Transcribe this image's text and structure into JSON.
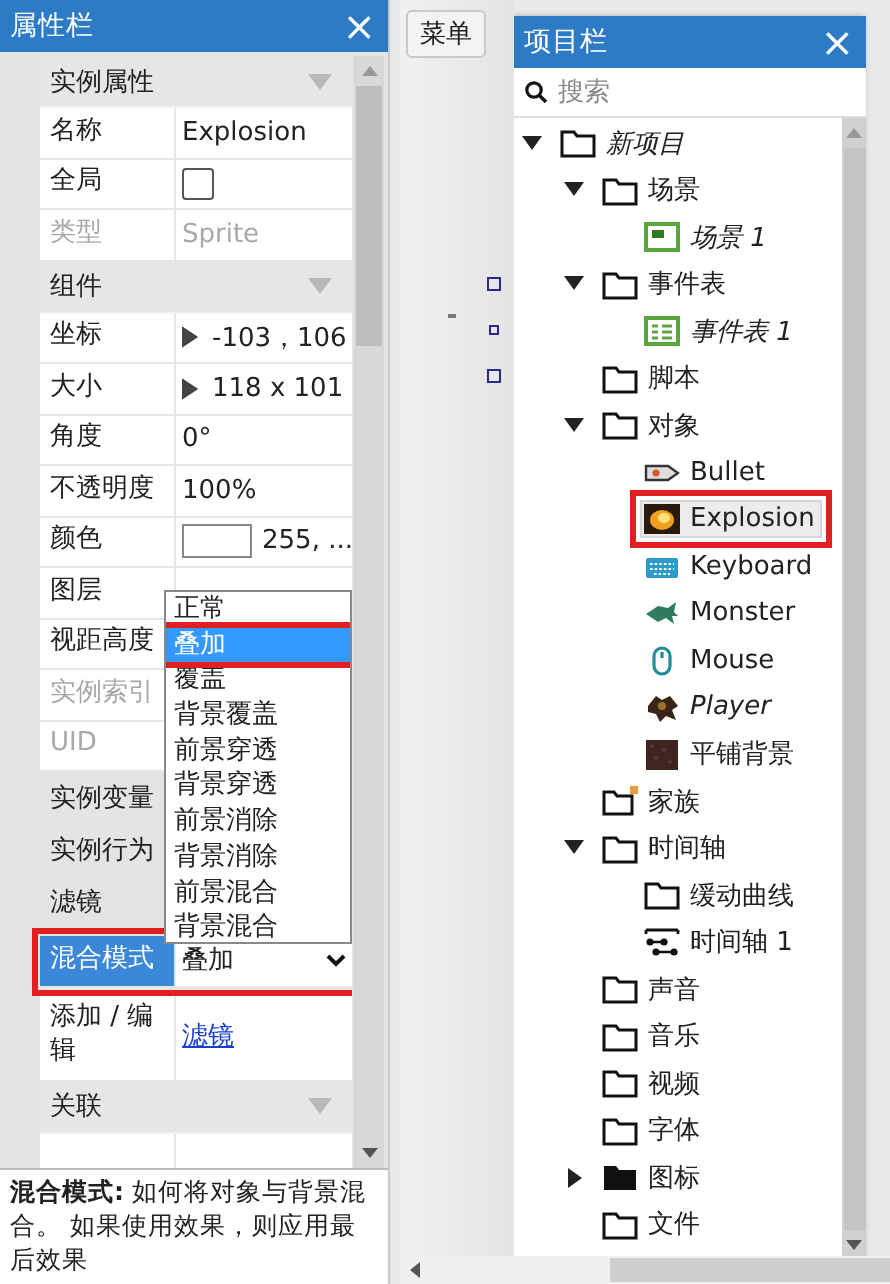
{
  "properties_panel": {
    "title": "属性栏",
    "close": "×",
    "rows": [
      {
        "kind": "section",
        "label": "实例属性"
      },
      {
        "kind": "text",
        "label": "名称",
        "value": "Explosion",
        "disabled": false,
        "selected": false
      },
      {
        "kind": "checkbox",
        "label": "全局",
        "checked": false,
        "disabled": false,
        "selected": false
      },
      {
        "kind": "text",
        "label": "类型",
        "value": "Sprite",
        "disabled": true,
        "selected": false
      },
      {
        "kind": "section",
        "label": "组件"
      },
      {
        "kind": "text",
        "label": "坐标",
        "value": "-103，106",
        "expanded": false,
        "disabled": false,
        "selected": false
      },
      {
        "kind": "text",
        "label": "大小",
        "value": "118 x 101",
        "expanded": false,
        "disabled": false,
        "selected": false
      },
      {
        "kind": "text",
        "label": "角度",
        "value": "0°",
        "disabled": false,
        "selected": false
      },
      {
        "kind": "text",
        "label": "不透明度",
        "value": "100%",
        "disabled": false,
        "selected": false
      },
      {
        "kind": "color",
        "label": "颜色",
        "value": "255, ...",
        "disabled": false,
        "selected": false
      },
      {
        "kind": "text",
        "label": "图层",
        "disabled": false,
        "selected": false
      },
      {
        "kind": "text",
        "label": "视距高度",
        "disabled": false,
        "selected": false
      },
      {
        "kind": "text",
        "label": "实例索引",
        "disabled": true,
        "selected": false
      },
      {
        "kind": "text",
        "label": "UID",
        "disabled": true,
        "selected": false
      },
      {
        "kind": "group",
        "label": "实例变量"
      },
      {
        "kind": "group",
        "label": "实例行为"
      },
      {
        "kind": "group",
        "label": "滤镜"
      },
      {
        "kind": "select",
        "label": "混合模式",
        "value": "叠加",
        "disabled": false,
        "selected": true,
        "red_box": true
      },
      {
        "kind": "link",
        "label": "添加 / 编辑",
        "value": "滤镜",
        "disabled": false,
        "selected": false
      },
      {
        "kind": "section",
        "label": "关联"
      }
    ],
    "dropdown": [
      {
        "label": "正常",
        "selected": false
      },
      {
        "label": "叠加",
        "selected": true,
        "red_box": true
      },
      {
        "label": "覆盖",
        "selected": false
      },
      {
        "label": "背景覆盖",
        "selected": false
      },
      {
        "label": "前景穿透",
        "selected": false
      },
      {
        "label": "背景穿透",
        "selected": false
      },
      {
        "label": "前景消除",
        "selected": false
      },
      {
        "label": "背景消除",
        "selected": false
      },
      {
        "label": "前景混合",
        "selected": false
      },
      {
        "label": "背景混合",
        "selected": false
      }
    ],
    "help": "**混合模式:** 如何将对象与背景混合。 如果使用效果，则应用最后效果"
  },
  "menu_button": "菜单",
  "project_panel": {
    "title": "项目栏",
    "close": "×",
    "search_placeholder": "搜索",
    "items": [
      {
        "label": "新项目",
        "kind": "folder",
        "italic": true,
        "selected": false,
        "expanded": true,
        "children": [
          {
            "label": "场景",
            "kind": "folder",
            "italic": false,
            "selected": false,
            "expanded": true,
            "children": [
              {
                "label": "场景 1",
                "kind": "scene",
                "italic": true,
                "selected": false
              }
            ]
          },
          {
            "label": "事件表",
            "kind": "folder",
            "italic": false,
            "selected": false,
            "expanded": true,
            "children": [
              {
                "label": "事件表 1",
                "kind": "event-sheet",
                "italic": true,
                "selected": false
              }
            ]
          },
          {
            "label": "脚本",
            "kind": "folder",
            "italic": false,
            "selected": false
          },
          {
            "label": "对象",
            "kind": "folder",
            "italic": false,
            "selected": false,
            "expanded": true,
            "children": [
              {
                "label": "Bullet",
                "kind": "bullet",
                "italic": false,
                "selected": false
              },
              {
                "label": "Explosion",
                "kind": "explosion",
                "italic": false,
                "selected": true,
                "red_box": true
              },
              {
                "label": "Keyboard",
                "kind": "keyboard",
                "italic": false,
                "selected": false
              },
              {
                "label": "Monster",
                "kind": "monster",
                "italic": false,
                "selected": false
              },
              {
                "label": "Mouse",
                "kind": "mouse",
                "italic": false,
                "selected": false
              },
              {
                "label": "Player",
                "kind": "player",
                "italic": true,
                "selected": false
              },
              {
                "label": "平铺背景",
                "kind": "tiled-background",
                "italic": false,
                "selected": false
              }
            ]
          },
          {
            "label": "家族",
            "kind": "family",
            "italic": false,
            "selected": false
          },
          {
            "label": "时间轴",
            "kind": "folder",
            "italic": false,
            "selected": false,
            "expanded": true,
            "children": [
              {
                "label": "缓动曲线",
                "kind": "folder",
                "italic": false,
                "selected": false
              },
              {
                "label": "时间轴 1",
                "kind": "timeline",
                "italic": false,
                "selected": false
              }
            ]
          },
          {
            "label": "声音",
            "kind": "folder",
            "italic": false,
            "selected": false
          },
          {
            "label": "音乐",
            "kind": "folder",
            "italic": false,
            "selected": false
          },
          {
            "label": "视频",
            "kind": "folder",
            "italic": false,
            "selected": false
          },
          {
            "label": "字体",
            "kind": "folder",
            "italic": false,
            "selected": false
          },
          {
            "label": "图标",
            "kind": "folder-filled",
            "italic": false,
            "selected": false,
            "expanded": false
          },
          {
            "label": "文件",
            "kind": "folder",
            "italic": false,
            "selected": false
          }
        ]
      }
    ]
  }
}
